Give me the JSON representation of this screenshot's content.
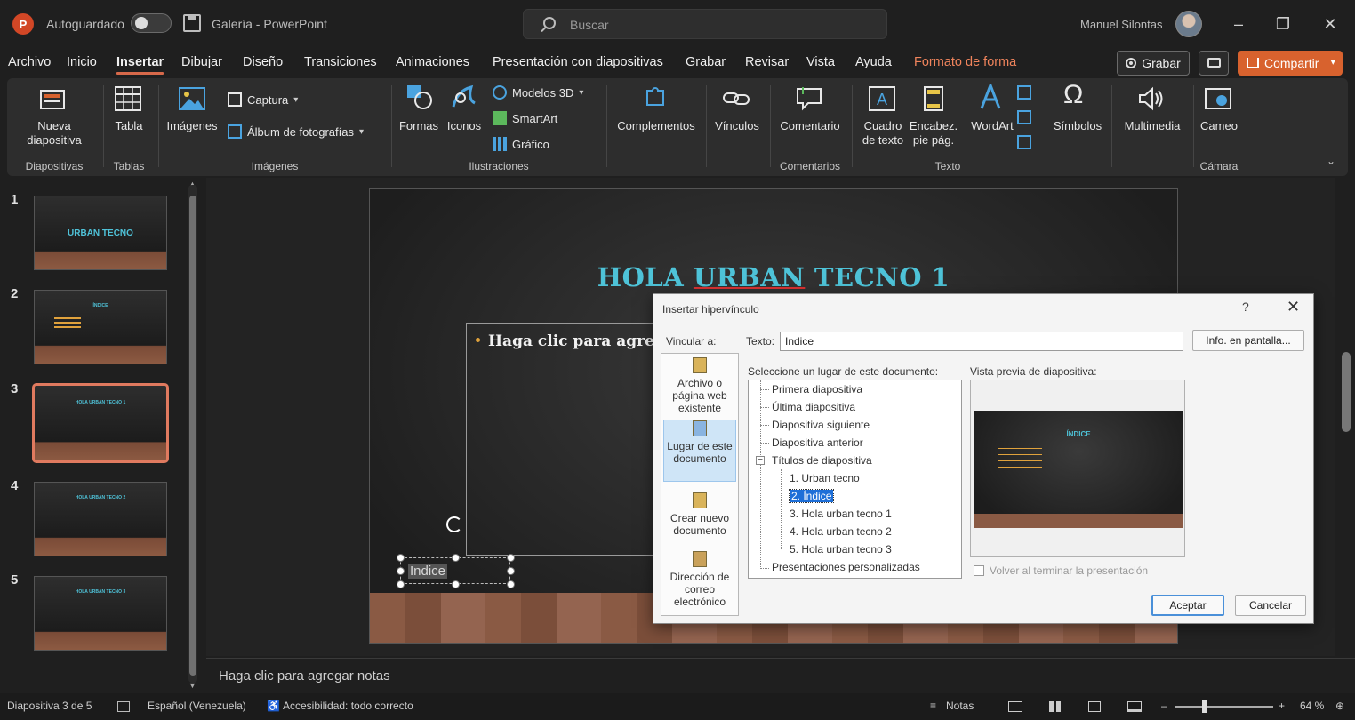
{
  "titlebar": {
    "autosave_label": "Autoguardado",
    "document_title": "Galería - PowerPoint",
    "search_placeholder": "Buscar",
    "user_name": "Manuel Silontas"
  },
  "menu": {
    "tabs": [
      "Archivo",
      "Inicio",
      "Insertar",
      "Dibujar",
      "Diseño",
      "Transiciones",
      "Animaciones",
      "Presentación con diapositivas",
      "Grabar",
      "Revisar",
      "Vista",
      "Ayuda",
      "Formato de forma"
    ],
    "active_tab": "Insertar",
    "record_label": "Grabar",
    "share_label": "Compartir"
  },
  "ribbon": {
    "new_slide": "Nueva diapositiva",
    "table": "Tabla",
    "images": "Imágenes",
    "capture": "Captura",
    "album": "Álbum de fotografías",
    "shapes": "Formas",
    "icons": "Iconos",
    "models3d": "Modelos 3D",
    "smartart": "SmartArt",
    "chart": "Gráfico",
    "addins": "Complementos",
    "links": "Vínculos",
    "comment": "Comentario",
    "textbox": "Cuadro de texto",
    "header": "Encabez. pie pág.",
    "wordart": "WordArt",
    "symbols": "Símbolos",
    "multimedia": "Multimedia",
    "cameo": "Cameo",
    "groups": {
      "slides": "Diapositivas",
      "tables": "Tablas",
      "images": "Imágenes",
      "illustrations": "Ilustraciones",
      "comments": "Comentarios",
      "text": "Texto",
      "camera": "Cámara"
    }
  },
  "thumbnails": [
    {
      "number": "1",
      "title": "URBAN TECNO"
    },
    {
      "number": "2",
      "title": "ÍNDICE"
    },
    {
      "number": "3",
      "title": "HOLA URBAN TECNO 1"
    },
    {
      "number": "4",
      "title": "HOLA URBAN TECNO 2"
    },
    {
      "number": "5",
      "title": "HOLA URBAN TECNO 3"
    }
  ],
  "slide": {
    "title_part1": "HOLA ",
    "title_part2": "URBAN",
    "title_part3": " TECNO 1",
    "content_placeholder": "Haga clic para agregar",
    "selected_text": "Indice"
  },
  "notes_placeholder": "Haga clic para agregar notas",
  "status": {
    "slide_count": "Diapositiva 3 de 5",
    "language": "Español (Venezuela)",
    "accessibility": "Accesibilidad: todo correcto",
    "notes": "Notas",
    "zoom": "64 %"
  },
  "dialog": {
    "title": "Insertar hipervínculo",
    "link_to": "Vincular a:",
    "text_label": "Texto:",
    "text_value": "Indice",
    "screentip": "Info. en pantalla...",
    "select_place": "Seleccione un lugar de este documento:",
    "preview_label": "Vista previa de diapositiva:",
    "link_options": [
      "Archivo o página web existente",
      "Lugar de este documento",
      "Crear nuevo documento",
      "Dirección de correo electrónico"
    ],
    "tree": [
      "Primera diapositiva",
      "Última diapositiva",
      "Diapositiva siguiente",
      "Diapositiva anterior",
      "Títulos de diapositiva",
      "1. Urban tecno",
      "2. Índice",
      "3. Hola urban tecno 1",
      "4. Hola urban tecno 2",
      "5. Hola urban tecno 3",
      "Presentaciones personalizadas"
    ],
    "selected_item": "2. Índice",
    "show_and_return": "Volver al terminar la presentación",
    "ok": "Aceptar",
    "cancel": "Cancelar",
    "preview_title": "ÍNDICE"
  },
  "colors": {
    "accent": "#d8622e",
    "title_cyan": "#4ec3d8",
    "selection_blue": "#1e6fd8"
  }
}
